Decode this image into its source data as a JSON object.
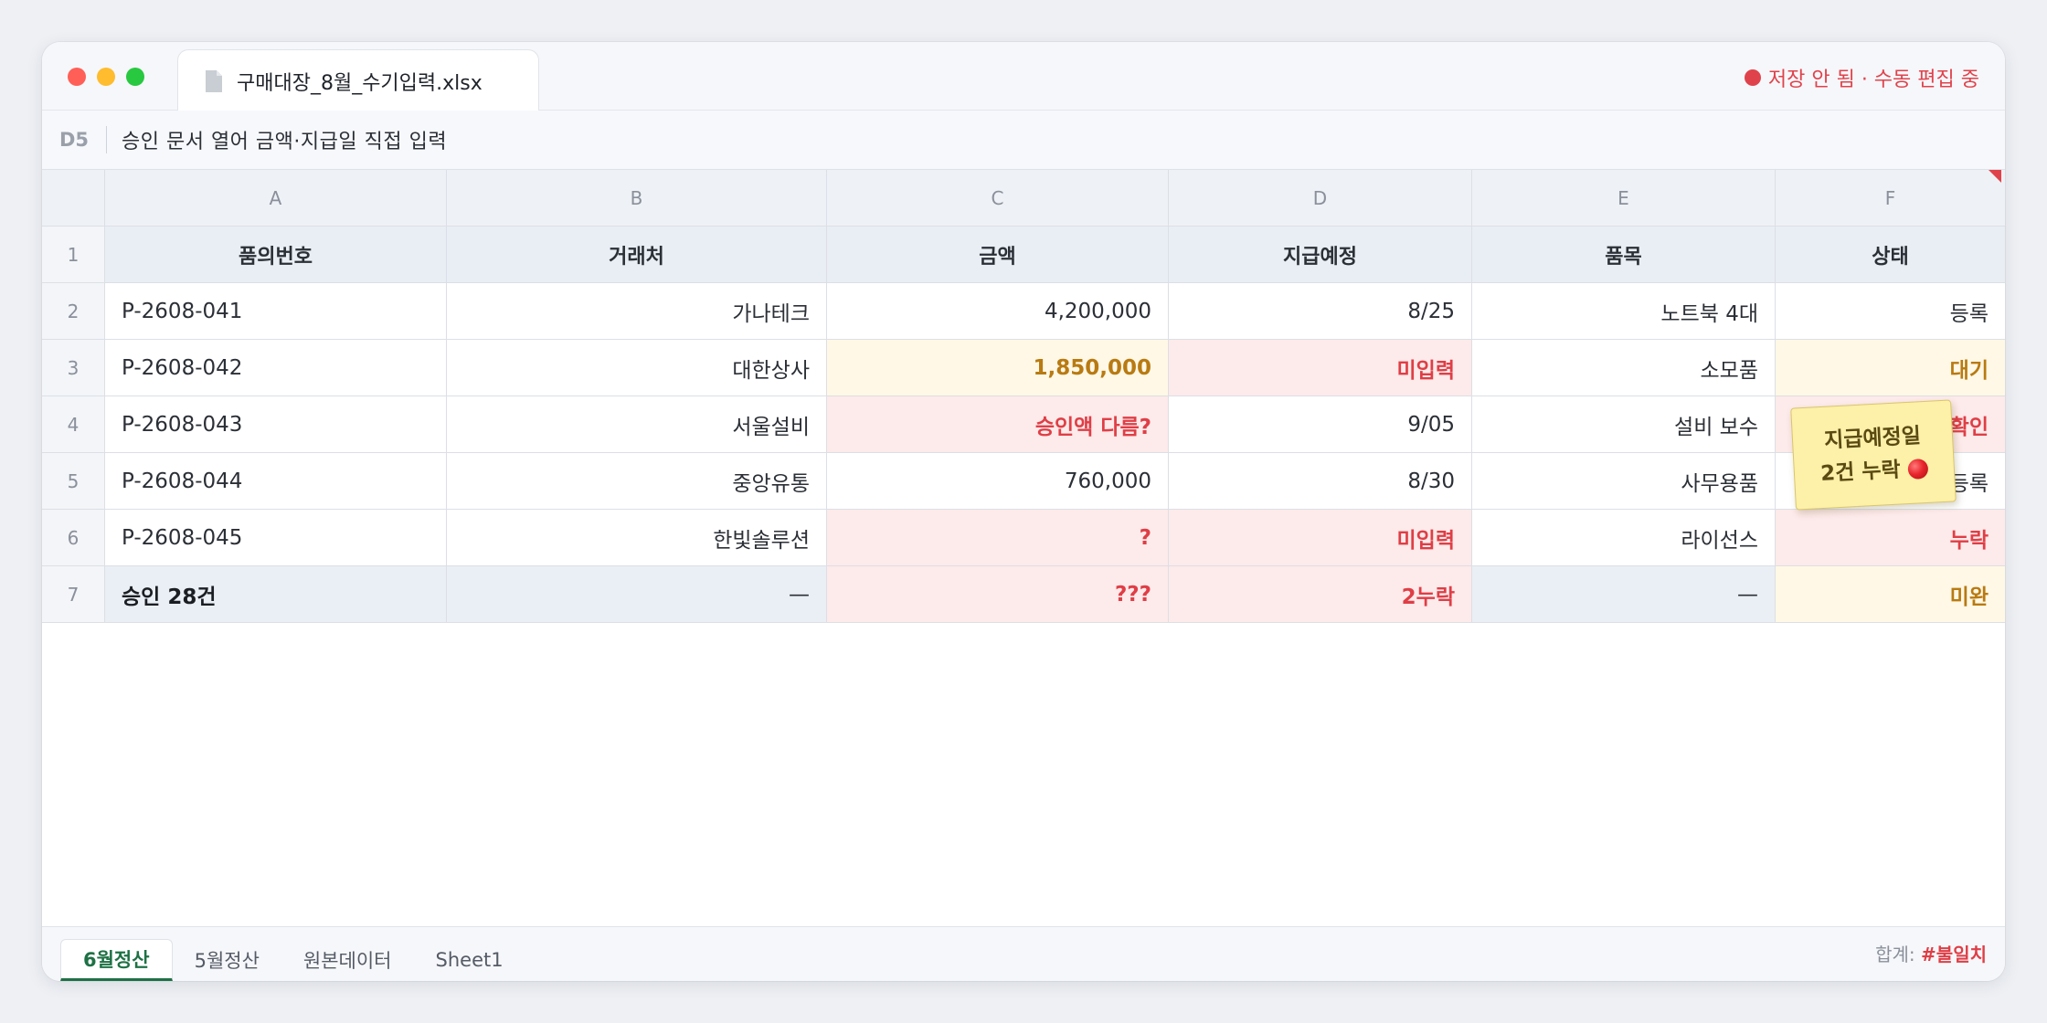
{
  "window": {
    "file_tab": "구매대장_8월_수기입력.xlsx",
    "save_status": "저장 안 됨 · 수동 편집 중"
  },
  "formula_bar": {
    "cell_ref": "D5",
    "content": "승인 문서 열어 금액·지급일 직접 입력"
  },
  "columns": [
    "A",
    "B",
    "C",
    "D",
    "E",
    "F"
  ],
  "header": {
    "row_num": "1",
    "cells": [
      "품의번호",
      "거래처",
      "금액",
      "지급예정",
      "품목",
      "상태"
    ]
  },
  "rows": [
    {
      "num": "2",
      "a": "P-2608-041",
      "b": "가나테크",
      "c": "4,200,000",
      "d": "8/25",
      "e": "노트북 4대",
      "f": "등록"
    },
    {
      "num": "3",
      "a": "P-2608-042",
      "b": "대한상사",
      "c": "1,850,000",
      "d": "미입력",
      "e": "소모품",
      "f": "대기"
    },
    {
      "num": "4",
      "a": "P-2608-043",
      "b": "서울설비",
      "c": "승인액 다름?",
      "d": "9/05",
      "e": "설비 보수",
      "f": "확인"
    },
    {
      "num": "5",
      "a": "P-2608-044",
      "b": "중앙유통",
      "c": "760,000",
      "d": "8/30",
      "e": "사무용품",
      "f": "등록"
    },
    {
      "num": "6",
      "a": "P-2608-045",
      "b": "한빛솔루션",
      "c": "?",
      "d": "미입력",
      "e": "라이선스",
      "f": "누락"
    },
    {
      "num": "7",
      "a": "승인 28건",
      "b": "—",
      "c": "???",
      "d": "2누락",
      "e": "—",
      "f": "미완"
    }
  ],
  "sticky_note": {
    "line1": "지급예정일",
    "line2": "2건 누락"
  },
  "sheet_tabs": [
    "6월정산",
    "5월정산",
    "원본데이터",
    "Sheet1"
  ],
  "status_bar": {
    "sum_label": "합계:",
    "sum_value": "#불일치"
  },
  "colors": {
    "accent_green": "#1e7145",
    "error_red": "#df3e46",
    "warning_orange": "#b87a12"
  }
}
